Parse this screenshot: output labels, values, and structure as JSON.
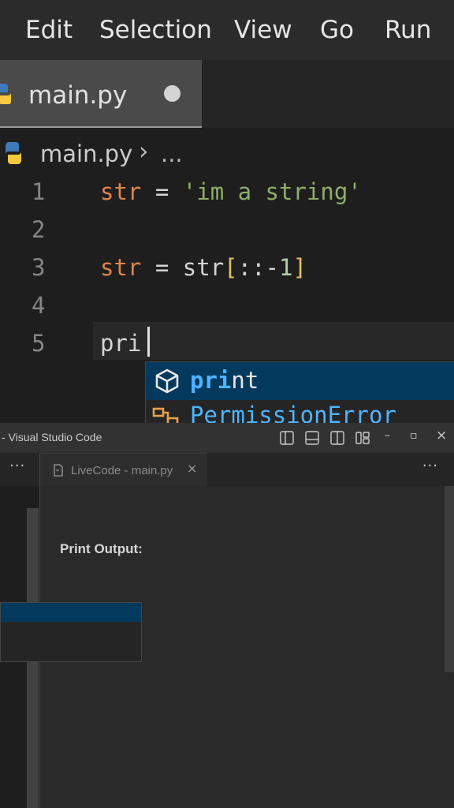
{
  "menubar": {
    "items": [
      "Edit",
      "Selection",
      "View",
      "Go",
      "Run"
    ]
  },
  "editor_tab": {
    "filename": "main.py"
  },
  "breadcrumb": {
    "file": "main.py",
    "more": "..."
  },
  "code": {
    "line_numbers": [
      "1",
      "2",
      "3",
      "4",
      "5"
    ],
    "line1": {
      "var": "str",
      "op": " = ",
      "string": "'im a string'"
    },
    "line3": {
      "var": "str",
      "op": " = ",
      "expr_start": "str",
      "lbr": "[",
      "slice": "::-",
      "num": "1",
      "rbr": "]"
    },
    "line5": {
      "typed": "pri"
    }
  },
  "suggestions": {
    "item1": {
      "match": "pri",
      "rest": "nt"
    },
    "item2": {
      "label": "PermissionError"
    }
  },
  "window": {
    "title": "- Visual Studio Code",
    "controls": {
      "minimize": "–",
      "restore": "▫",
      "close": "×"
    }
  },
  "left_group": {
    "more": "···"
  },
  "right_group": {
    "tab_label": "LiveCode - main.py",
    "close": "×",
    "more": "···"
  },
  "output": {
    "heading": "Print Output:"
  },
  "colors": {
    "accent": "#04395e",
    "string": "#8fae6a",
    "variable": "#e0844f",
    "match": "#4fb3ff"
  }
}
